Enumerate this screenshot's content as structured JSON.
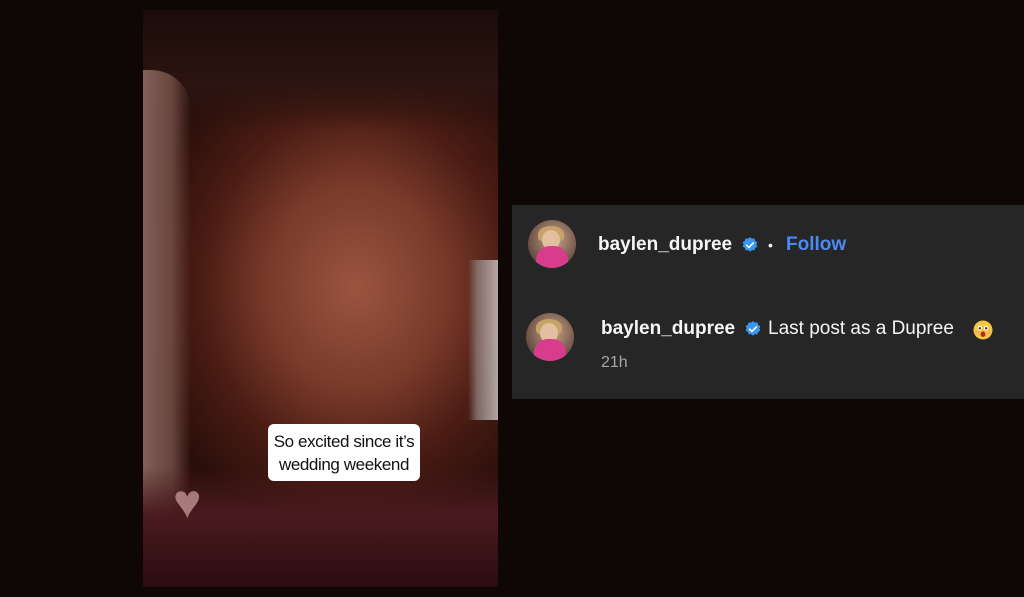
{
  "story": {
    "caption_line1": "So excited since it’s",
    "caption_line2": "wedding weekend"
  },
  "header": {
    "username": "baylen_dupree",
    "separator": "•",
    "follow_label": "Follow",
    "verified_icon": "verified-badge-icon"
  },
  "comment": {
    "username": "baylen_dupree",
    "text": "Last post as a Dupree",
    "emoji": "astonished-face-emoji",
    "timestamp": "21h"
  },
  "colors": {
    "panel_bg": "#262627",
    "follow_blue": "#4a8af4",
    "verified_blue": "#3797f0",
    "page_bg": "#0f0606"
  }
}
